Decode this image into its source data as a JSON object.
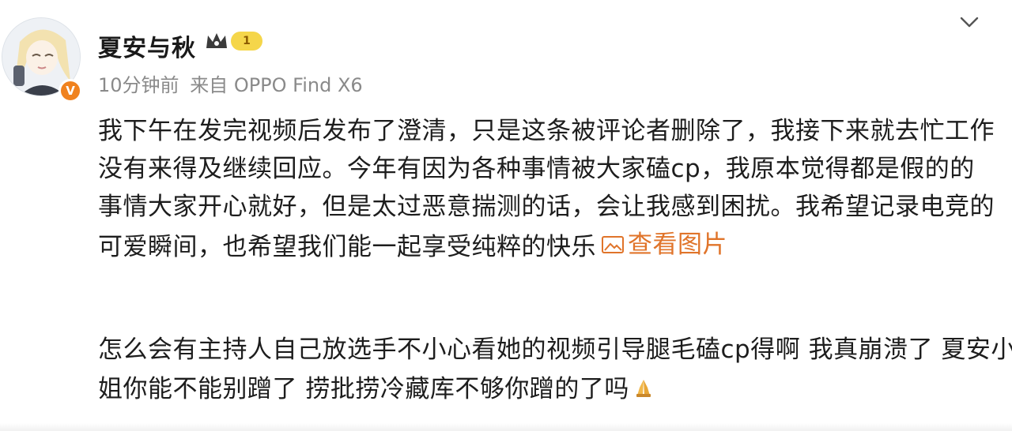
{
  "post": {
    "username": "夏安与秋",
    "level": "1",
    "time": "10分钟前",
    "source": "来自 OPPO Find X6",
    "verified_mark": "V",
    "text_lines": [
      "我下午在发完视频后发布了澄清，只是这条被评论者删除了，我接下来就去忙工作",
      "没有来得及继续回应。今年有因为各种事情被大家磕cp，我原本觉得都是假的的",
      "事情大家开心就好，但是太过恶意揣测的话，会让我感到困扰。我希望记录电竞的",
      "可爱瞬间，也希望我们能一起享受纯粹的快乐"
    ],
    "view_images_label": "查看图片"
  },
  "comment": {
    "lines": [
      "怎么会有主持人自己放选手不小心看她的视频引导腿毛磕cp得啊 我真崩溃了 夏安小姐",
      "姐你能不能别蹭了 捞批捞冷藏库不够你蹭的了吗"
    ]
  },
  "icons": {
    "more": "chevron-down-icon",
    "image": "image-icon",
    "crown": "crown-icon",
    "pray": "praying-hands-emoji"
  },
  "colors": {
    "accent": "#e0742a",
    "verified": "#f0821e",
    "meta": "#8a8a8a"
  }
}
